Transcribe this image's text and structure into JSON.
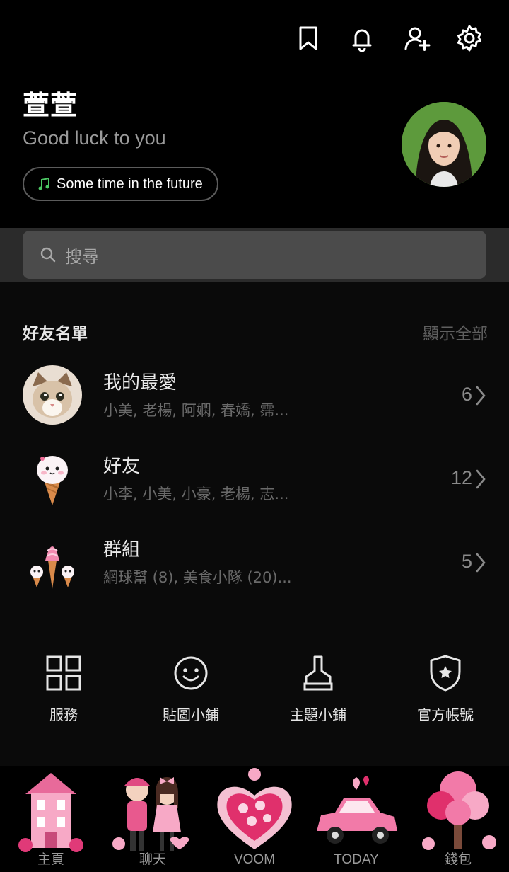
{
  "header": {
    "icons": [
      "bookmark-icon",
      "bell-icon",
      "add-friend-icon",
      "gear-icon"
    ]
  },
  "profile": {
    "name": "萱萱",
    "status": "Good luck to you",
    "music": "Some time in the future"
  },
  "search": {
    "placeholder": "搜尋"
  },
  "friends_section": {
    "title": "好友名單",
    "show_all": "顯示全部",
    "rows": [
      {
        "title": "我的最愛",
        "subtitle": "小美, 老楊, 阿嫻, 春嬌, 霈...",
        "count": "6"
      },
      {
        "title": "好友",
        "subtitle": "小李, 小美, 小豪, 老楊, 志...",
        "count": "12"
      },
      {
        "title": "群組",
        "subtitle": "網球幫 (8), 美食小隊 (20)...",
        "count": "5"
      }
    ]
  },
  "services": [
    {
      "label": "服務",
      "icon": "grid-icon"
    },
    {
      "label": "貼圖小鋪",
      "icon": "smiley-icon"
    },
    {
      "label": "主題小鋪",
      "icon": "brush-icon"
    },
    {
      "label": "官方帳號",
      "icon": "shield-star-icon"
    }
  ],
  "bottom_nav": [
    {
      "label": "主頁",
      "icon": "pink-house-icon"
    },
    {
      "label": "聊天",
      "icon": "couple-icon"
    },
    {
      "label": "VOOM",
      "icon": "heart-box-icon"
    },
    {
      "label": "TODAY",
      "icon": "pink-car-icon"
    },
    {
      "label": "錢包",
      "icon": "pink-tree-icon"
    }
  ],
  "colors": {
    "background": "#000000",
    "list_background": "#0a0a0a",
    "search_band": "#2b2b2b",
    "search_box": "#4b4b4b",
    "music_note": "#4cc764",
    "muted_text": "#6a6a6a"
  }
}
